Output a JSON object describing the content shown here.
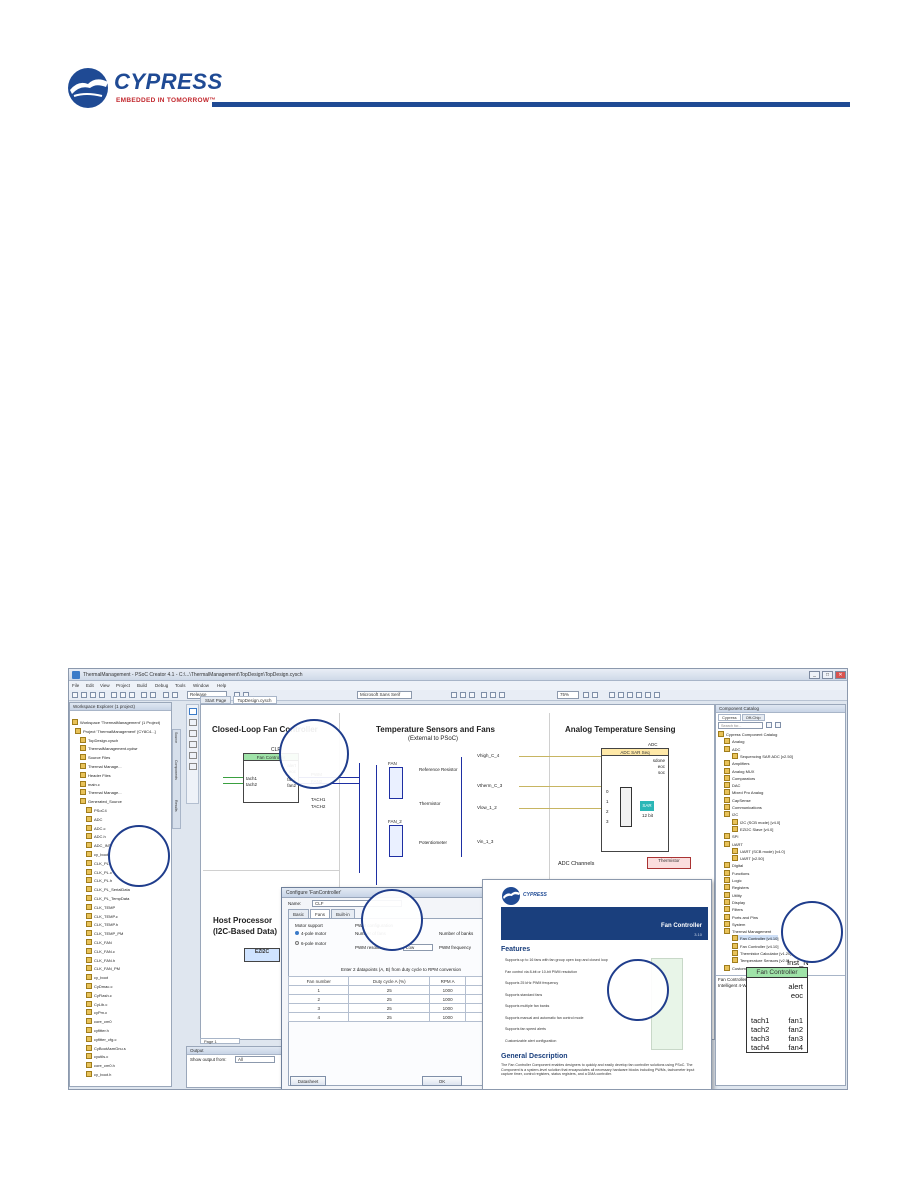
{
  "logo": {
    "name": "CYPRESS",
    "tagline": "EMBEDDED IN TOMORROW™"
  },
  "window": {
    "title": "ThermalManagement - PSoC Creator 4.1 - C:\\...\\ThermalManagement\\TopDesign\\TopDesign.cysch",
    "min": "_",
    "max": "□",
    "close": "✕",
    "menu": [
      "File",
      "Edit",
      "View",
      "Project",
      "Build",
      "Debug",
      "Tools",
      "Window",
      "Help"
    ],
    "toolbar": {
      "config": "Release",
      "font": "Microsoft Sans Serif",
      "zoom": "75%"
    }
  },
  "workspace": {
    "title": "Workspace Explorer (1 project)",
    "items": [
      "Workspace 'ThermalManagement' (1 Project)",
      "Project 'ThermalManagement' [CY8C4...]",
      "TopDesign.cysch",
      "ThermalManagement.cydwr",
      "Source Files",
      "Thermal Manage...",
      "Header Files",
      "main.c",
      "Thermal Manage...",
      "Generated_Source",
      "PSoC4",
      "ADC",
      "ADC.c",
      "ADC.h",
      "ADC_INT.c",
      "cy_boot",
      "CLK_PL",
      "CLK_PL.c",
      "CLK_PL.h",
      "CLK_PL_SerialData",
      "CLK_PL_TempData",
      "CLK_TEMP",
      "CLK_TEMP.c",
      "CLK_TEMP.h",
      "CLK_TEMP_PM",
      "CLK_FAN",
      "CLK_FAN.c",
      "CLK_FAN.h",
      "CLK_FAN_PM",
      "cy_boot",
      "CyDmac.c",
      "CyFlash.c",
      "CyLib.c",
      "cyPm.c",
      "core_cm0",
      "cyfitter.h",
      "cyfitter_cfg.c",
      "CyBootAsmGnu.s",
      "cyutils.c",
      "core_cm0.h",
      "cy_boot.h"
    ],
    "side_tabs": [
      "Source",
      "Components",
      "Results"
    ]
  },
  "editor": {
    "tabs": [
      "Start Page",
      "TopDesign.cysch"
    ],
    "page_tab": "Page 1",
    "sections": [
      {
        "title": "Closed-Loop Fan Controller",
        "subtitle": ""
      },
      {
        "title": "Temperature Sensors and Fans",
        "subtitle": "(External to PSoC)"
      },
      {
        "title": "Analog Temperature Sensing",
        "subtitle": ""
      },
      {
        "title": "Host Processor",
        "subtitle": "(I2C-Based Data)"
      }
    ],
    "fan_block": {
      "ref": "CLF",
      "header": "Fan Controller",
      "pins_left": [
        "tach1",
        "tach2"
      ],
      "pins_right": [
        "alert",
        "eoc",
        "fan1",
        "fan2"
      ]
    },
    "net_labels": [
      "PWM",
      "FAN2",
      "TACH1",
      "TACH2",
      "FAN",
      "FAN_2"
    ],
    "sensor_labels": [
      "Reference Resistor",
      "Thermistor",
      "Potentiometer"
    ],
    "sensor_nets": [
      "Vhigh_C_4",
      "Vtherm_C_3",
      "Vlow_1_2",
      "Vin_1_3"
    ],
    "adc": {
      "ref": "ADC",
      "header": "ADC SAR Seq",
      "pins": [
        "sdone",
        "eoc",
        "soc"
      ],
      "channels": [
        "0",
        "1",
        "2",
        "3"
      ],
      "sar": "SAR",
      "bits": "12 bit"
    },
    "adc_channels": "ADC Channels",
    "thermistor_tag": "Thermistor",
    "ezi2c": "EZI2C",
    "output": {
      "title": "Output",
      "show_from": "Show output from:",
      "filter": "All"
    }
  },
  "dialog": {
    "title": "Configure 'FanController'",
    "name_label": "Name:",
    "name_value": "CLF",
    "tabs": [
      "Basic",
      "Fans",
      "Built-in"
    ],
    "motor_group": "Motor support",
    "motor_options": [
      "4-pole motor",
      "6-pole motor"
    ],
    "pwm_group": "PWM configuration",
    "number_of_fans": "Number of fans",
    "pwm_resolution": "PWM resolution",
    "pwm_value": "Low",
    "number_of_banks": "Number of banks",
    "pwm_frequency": "PWM frequency",
    "table_caption": "Enter 2 datapoints (A, B) from duty cycle to RPM conversion",
    "headers": [
      "Fan number",
      "Duty cycle A (%)",
      "RPM A",
      "Duty cycle B (%)"
    ],
    "rows": [
      [
        "1",
        "25",
        "1000",
        "100"
      ],
      [
        "2",
        "25",
        "1000",
        "100"
      ],
      [
        "3",
        "25",
        "1000",
        "100"
      ],
      [
        "4",
        "25",
        "1000",
        "100"
      ]
    ],
    "datasheet_btn": "Datasheet",
    "ok_btn": "OK"
  },
  "datasheet": {
    "brand": "CYPRESS",
    "title": "Fan Controller",
    "version": "3.10",
    "features_heading": "Features",
    "features": [
      "Supports up to 16 fans with fan group open loop and closed loop",
      "Fan control via 8-bit or 10-bit PWM resolution",
      "Supports 25 kHz PWM frequency",
      "Supports standard fans",
      "Supports multiple fan banks",
      "Supports manual and automatic fan control mode",
      "Supports fan speed alerts",
      "Customizable alert configuration"
    ],
    "general_heading": "General Description",
    "general_text": "The Fan Controller Component enables designers to quickly and easily develop fan controller solutions using PSoC. The Component is a system-level solution that encapsulates all necessary hardware blocks including PWMs, tachometer input capture timer, control registers, status registers, and a DMA controller."
  },
  "catalog": {
    "title": "Component Catalog",
    "tabs": [
      "Cypress",
      "Off-Chip"
    ],
    "search": "Search for...",
    "items": [
      "Cypress Component Catalog",
      "Analog",
      "ADC",
      "Sequencing SAR ADC [v2.50]",
      "Amplifiers",
      "Analog MUX",
      "Comparators",
      "DAC",
      "Mixed Pro Analog",
      "CapSense",
      "Communications",
      "I2C",
      "I2C (SCB mode) [v4.0]",
      "EZI2C Slave [v4.0]",
      "SPI",
      "UART",
      "UART (SCB mode) [v4.0]",
      "UART [v2.50]",
      "Digital",
      "Functions",
      "Logic",
      "Registers",
      "Utility",
      "Display",
      "Filters",
      "Ports and Pins",
      "System",
      "Thermal Management",
      "Fan Controller [v4.10]",
      "Fan Controller [v4.10]",
      "Thermistor Calculator [v1.20]",
      "Temperature Sensors [v2.0]",
      "Custom"
    ],
    "selected_name": "Fan Controller",
    "selected_desc": "Intelligent 4-Wire Fan Controller",
    "inst_name": "Inst_N",
    "fc_header": "Fan Controller",
    "fc_left": [
      "tach1",
      "tach2",
      "tach3",
      "tach4"
    ],
    "fc_right": [
      "alert",
      "eoc",
      "fan1",
      "fan2",
      "fan3",
      "fan4"
    ]
  },
  "colors": {
    "brand_blue": "#1f4a94",
    "brand_red": "#c2272d",
    "callout": "#1f3d8c",
    "block_green": "#9fe3a8"
  }
}
